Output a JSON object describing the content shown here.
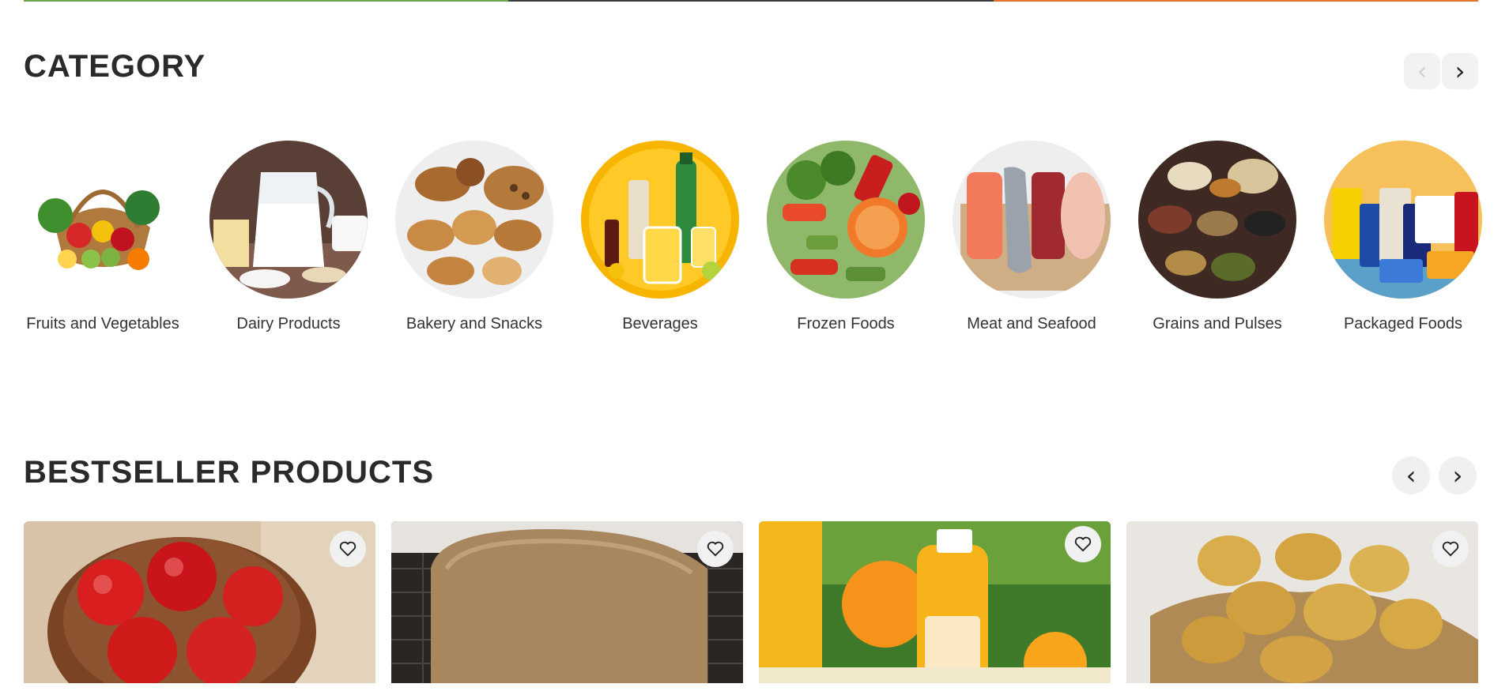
{
  "colors": {
    "bar_green": "#6aa84f",
    "bar_dark": "#3c3c3c",
    "bar_orange": "#e8712a"
  },
  "category": {
    "title": "CATEGORY",
    "prev_icon": "chevron-left-icon",
    "next_icon": "chevron-right-icon",
    "prev_label": "‹",
    "next_label": "›",
    "items": [
      {
        "label": "Fruits and Vegetables",
        "icon": "fruits-vegetables-image"
      },
      {
        "label": "Dairy Products",
        "icon": "dairy-image"
      },
      {
        "label": "Bakery and Snacks",
        "icon": "bakery-image"
      },
      {
        "label": "Beverages",
        "icon": "beverages-image"
      },
      {
        "label": "Frozen Foods",
        "icon": "frozen-foods-image"
      },
      {
        "label": "Meat and Seafood",
        "icon": "meat-seafood-image"
      },
      {
        "label": "Grains and Pulses",
        "icon": "grains-pulses-image"
      },
      {
        "label": "Packaged Foods",
        "icon": "packaged-foods-image"
      }
    ]
  },
  "bestseller": {
    "title": "BESTSELLER PRODUCTS",
    "prev_label": "‹",
    "next_label": "›",
    "products": [
      {
        "image": "apples-image",
        "wishlist_icon": "heart-icon"
      },
      {
        "image": "bread-loaf-image",
        "wishlist_icon": "heart-icon"
      },
      {
        "image": "orange-juice-image",
        "wishlist_icon": "heart-icon"
      },
      {
        "image": "potatoes-image",
        "wishlist_icon": "heart-icon"
      }
    ]
  }
}
